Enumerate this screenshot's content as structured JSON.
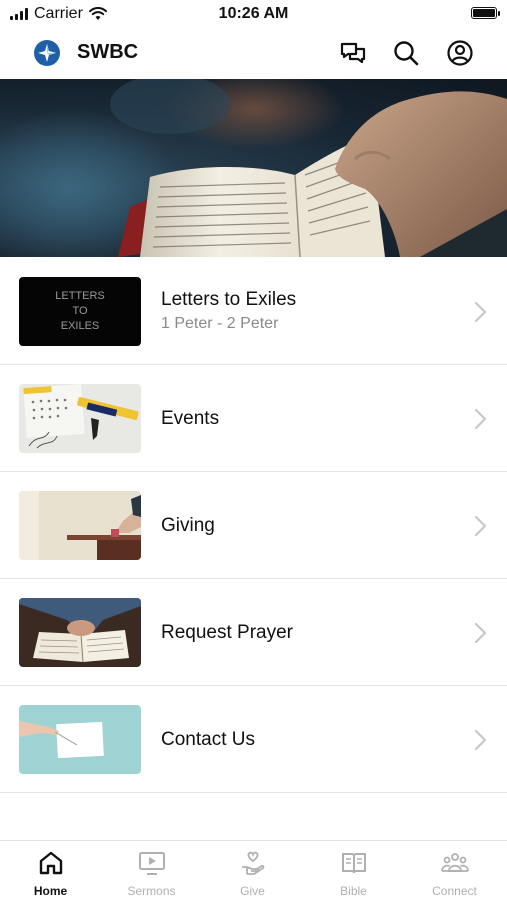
{
  "status_bar": {
    "carrier": "Carrier",
    "time": "10:26 AM"
  },
  "header": {
    "title": "SWBC"
  },
  "hero": {
    "icon": "open-bible-photo"
  },
  "items": [
    {
      "title": "Letters to Exiles",
      "subtitle": "1 Peter - 2 Peter",
      "thumb_text": [
        "LETTERS",
        "TO",
        "EXILES"
      ]
    },
    {
      "title": "Events"
    },
    {
      "title": "Giving"
    },
    {
      "title": "Request Prayer"
    },
    {
      "title": "Contact Us"
    }
  ],
  "tabs": [
    {
      "label": "Home",
      "icon": "home-icon",
      "active": true
    },
    {
      "label": "Sermons",
      "icon": "tv-icon",
      "active": false
    },
    {
      "label": "Give",
      "icon": "giving-hand-icon",
      "active": false
    },
    {
      "label": "Bible",
      "icon": "book-icon",
      "active": false
    },
    {
      "label": "Connect",
      "icon": "people-icon",
      "active": false
    }
  ],
  "colors": {
    "accent": "#1f5fa8",
    "active_tab": "#111111",
    "inactive_tab": "#b0b0b0",
    "divider": "#e6e6e6"
  }
}
